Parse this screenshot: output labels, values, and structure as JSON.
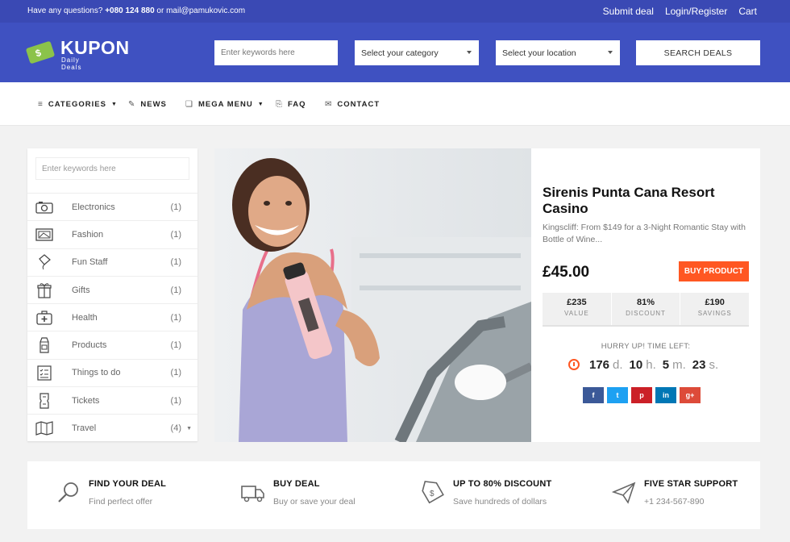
{
  "topbar": {
    "question": "Have any questions?",
    "phone": "+080 124 880",
    "or_mail": "or mail@pamukovic.com",
    "links": [
      "Submit deal",
      "Login/Register",
      "Cart"
    ]
  },
  "header": {
    "logo_title": "KUPON",
    "logo_sub": "Daily Deals",
    "keyword_placeholder": "Enter keywords here",
    "category_select": "Select your category",
    "location_select": "Select your location",
    "search_button": "SEARCH DEALS"
  },
  "nav": [
    {
      "label": "CATEGORIES",
      "icon": "list-icon",
      "dropdown": true
    },
    {
      "label": "NEWS",
      "icon": "pencil-icon",
      "dropdown": false
    },
    {
      "label": "MEGA MENU",
      "icon": "window-icon",
      "dropdown": true
    },
    {
      "label": "FAQ",
      "icon": "clipboard-icon",
      "dropdown": false
    },
    {
      "label": "CONTACT",
      "icon": "envelope-icon",
      "dropdown": false
    }
  ],
  "sidebar": {
    "search_placeholder": "Enter keywords here",
    "categories": [
      {
        "name": "Electronics",
        "count": "(1)",
        "icon": "camera-icon"
      },
      {
        "name": "Fashion",
        "count": "(1)",
        "icon": "picture-icon"
      },
      {
        "name": "Fun Staff",
        "count": "(1)",
        "icon": "kite-icon"
      },
      {
        "name": "Gifts",
        "count": "(1)",
        "icon": "gift-icon"
      },
      {
        "name": "Health",
        "count": "(1)",
        "icon": "first-aid-icon"
      },
      {
        "name": "Products",
        "count": "(1)",
        "icon": "milk-carton-icon"
      },
      {
        "name": "Things to do",
        "count": "(1)",
        "icon": "checklist-icon"
      },
      {
        "name": "Tickets",
        "count": "(1)",
        "icon": "ticket-icon"
      },
      {
        "name": "Travel",
        "count": "(4)",
        "icon": "map-icon"
      }
    ]
  },
  "deal": {
    "title": "Sirenis Punta Cana Resort Casino",
    "description": "Kingscliff: From $149 for a 3-Night Romantic Stay with Bottle of Wine...",
    "price": "£45.00",
    "buy_button": "BUY PRODUCT",
    "stats": [
      {
        "value": "£235",
        "label": "VALUE"
      },
      {
        "value": "81%",
        "label": "DISCOUNT"
      },
      {
        "value": "£190",
        "label": "SAVINGS"
      }
    ],
    "hurry": "HURRY UP! TIME LEFT:",
    "timer": {
      "days": "176",
      "days_unit": "d.",
      "hours": "10",
      "hours_unit": "h.",
      "minutes": "5",
      "minutes_unit": "m.",
      "seconds": "23",
      "seconds_unit": "s."
    },
    "social": [
      {
        "label": "f",
        "name": "facebook",
        "color": "#3b5998"
      },
      {
        "label": "t",
        "name": "twitter",
        "color": "#1da1f2"
      },
      {
        "label": "p",
        "name": "pinterest",
        "color": "#cb2027"
      },
      {
        "label": "in",
        "name": "linkedin",
        "color": "#0077b5"
      },
      {
        "label": "g+",
        "name": "google-plus",
        "color": "#dd4b39"
      }
    ]
  },
  "features": [
    {
      "title": "FIND YOUR DEAL",
      "sub": "Find perfect offer",
      "icon": "magnifier-icon"
    },
    {
      "title": "BUY DEAL",
      "sub": "Buy or save your deal",
      "icon": "truck-icon"
    },
    {
      "title": "UP TO 80% DISCOUNT",
      "sub": "Save hundreds of dollars",
      "icon": "price-tag-icon"
    },
    {
      "title": "FIVE STAR SUPPORT",
      "sub": "+1 234-567-890",
      "icon": "paper-plane-icon"
    }
  ],
  "colors": {
    "topbar": "#3a49b4",
    "header": "#3f51c1",
    "accent": "#ff5722",
    "logo_green": "#8bc34a"
  }
}
